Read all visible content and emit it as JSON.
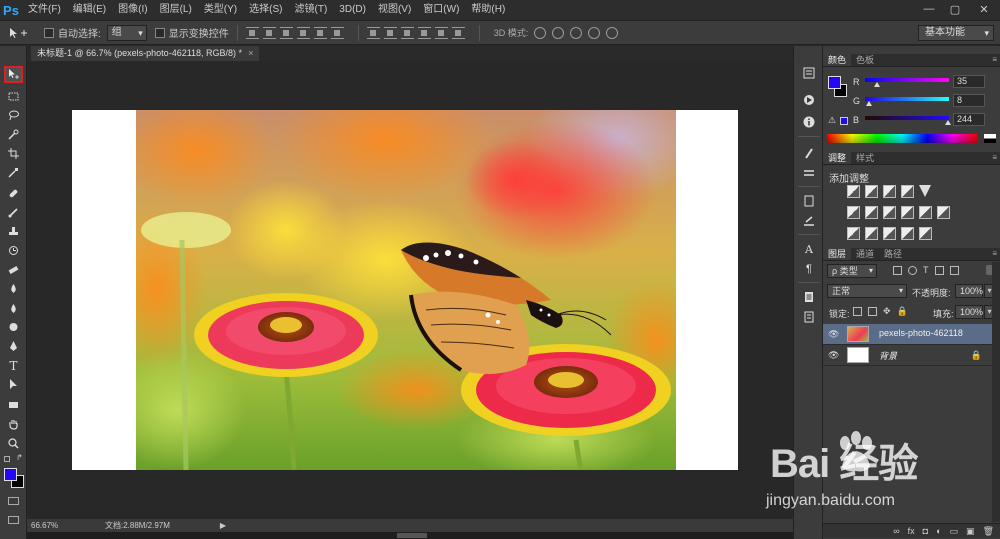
{
  "app": {
    "logo_text": "Ps",
    "menu": [
      "文件(F)",
      "编辑(E)",
      "图像(I)",
      "图层(L)",
      "类型(Y)",
      "选择(S)",
      "滤镜(T)",
      "3D(D)",
      "视图(V)",
      "窗口(W)",
      "帮助(H)"
    ],
    "window_controls": [
      "—",
      "▢",
      "✕"
    ]
  },
  "options_bar": {
    "auto_select_label": "自动选择:",
    "auto_select_value": "组",
    "show_transform_label": "显示变换控件",
    "mode_3d_label": "3D 模式:",
    "workspace_value": "基本功能"
  },
  "document": {
    "tab_title": "未标题-1 @ 66.7% (pexels-photo-462118, RGB/8) *",
    "tab_close": "×"
  },
  "status_bar": {
    "zoom": "66.67%",
    "doc_info": "文档:2.88M/2.97M",
    "arrow": "▶"
  },
  "color_panel": {
    "tabs": [
      "颜色",
      "色板"
    ],
    "foreground_hex": "#2308f4",
    "background_hex": "#000000",
    "r_label": "R",
    "g_label": "G",
    "b_label": "B",
    "r_value": "35",
    "g_value": "8",
    "b_value": "244"
  },
  "adjustments_panel": {
    "tabs": [
      "调整",
      "样式"
    ],
    "title": "添加调整"
  },
  "layers_panel": {
    "tabs": [
      "图层",
      "通道",
      "路径"
    ],
    "filter_value": "ρ 类型",
    "blend_mode": "正常",
    "opacity_label": "不透明度:",
    "opacity_value": "100%",
    "lock_label": "锁定:",
    "fill_label": "填充:",
    "fill_value": "100%",
    "layers": [
      {
        "name": "pexels-photo-462118",
        "selected": true
      },
      {
        "name": "背景",
        "selected": false
      }
    ],
    "footer_icons": [
      "∞",
      "fx",
      "◘",
      "◐",
      "▭",
      "▣",
      "🗑"
    ]
  },
  "watermark": {
    "brand": "Bai 经验",
    "url": "jingyan.baidu.com"
  }
}
